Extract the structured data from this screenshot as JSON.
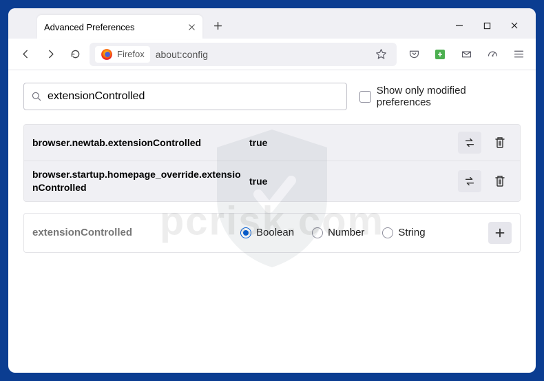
{
  "watermark": "pcrisk.com",
  "tab": {
    "title": "Advanced Preferences"
  },
  "identity": "Firefox",
  "url": "about:config",
  "search": {
    "value": "extensionControlled",
    "modified_only_label": "Show only modified preferences"
  },
  "prefs": [
    {
      "name": "browser.newtab.extensionControlled",
      "value": "true"
    },
    {
      "name": "browser.startup.homepage_override.extensionControlled",
      "value": "true"
    }
  ],
  "newPref": {
    "label": "extensionControlled",
    "options": {
      "boolean": "Boolean",
      "number": "Number",
      "string": "String"
    }
  }
}
